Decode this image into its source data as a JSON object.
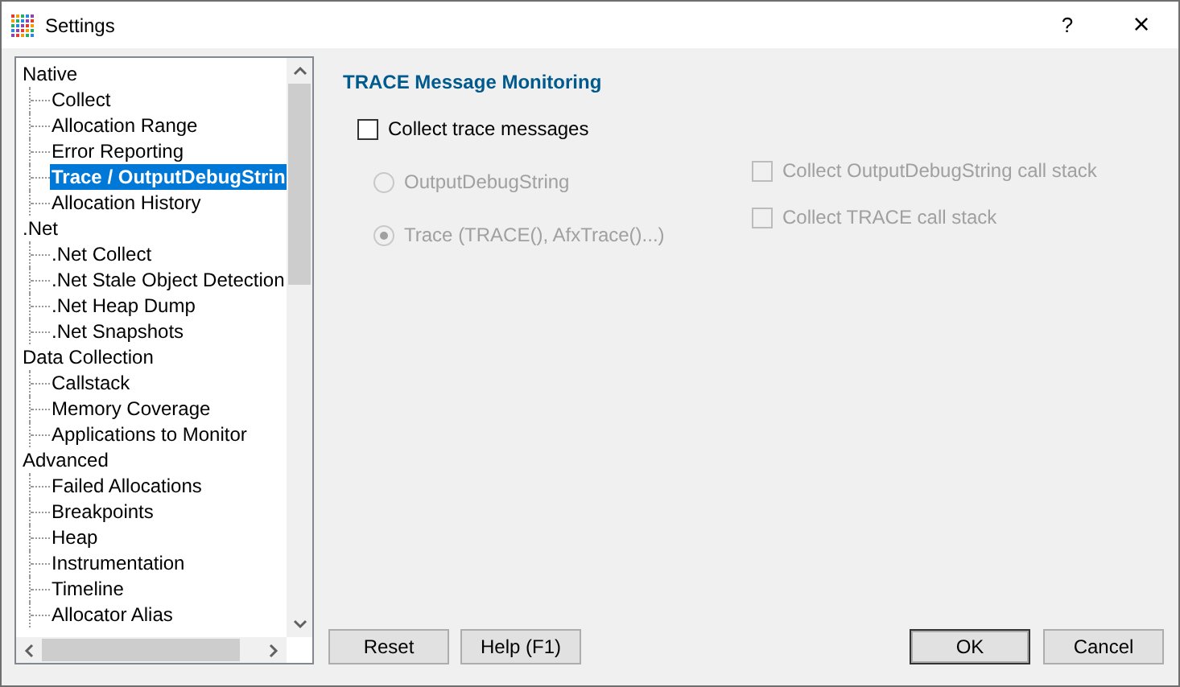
{
  "window": {
    "title": "Settings",
    "help": "?",
    "close": "×"
  },
  "tree": [
    {
      "label": "Native",
      "selected": false,
      "children": [
        {
          "label": "Collect",
          "selected": false
        },
        {
          "label": "Allocation Range",
          "selected": false
        },
        {
          "label": "Error Reporting",
          "selected": false
        },
        {
          "label": "Trace / OutputDebugStrin",
          "selected": true
        },
        {
          "label": "Allocation History",
          "selected": false
        }
      ]
    },
    {
      "label": ".Net",
      "selected": false,
      "children": [
        {
          "label": ".Net Collect",
          "selected": false
        },
        {
          "label": ".Net Stale Object Detection",
          "selected": false
        },
        {
          "label": ".Net Heap Dump",
          "selected": false
        },
        {
          "label": ".Net Snapshots",
          "selected": false
        }
      ]
    },
    {
      "label": "Data Collection",
      "selected": false,
      "children": [
        {
          "label": "Callstack",
          "selected": false
        },
        {
          "label": "Memory Coverage",
          "selected": false
        },
        {
          "label": "Applications to Monitor",
          "selected": false
        }
      ]
    },
    {
      "label": "Advanced",
      "selected": false,
      "children": [
        {
          "label": "Failed Allocations",
          "selected": false
        },
        {
          "label": "Breakpoints",
          "selected": false
        },
        {
          "label": "Heap",
          "selected": false
        },
        {
          "label": "Instrumentation",
          "selected": false
        },
        {
          "label": "Timeline",
          "selected": false
        },
        {
          "label": "Allocator Alias",
          "selected": false
        }
      ]
    }
  ],
  "panel": {
    "heading": "TRACE Message Monitoring",
    "collect": {
      "label": "Collect trace messages",
      "checked": false,
      "disabled": false
    },
    "sources": [
      {
        "label": "OutputDebugString",
        "selected": false,
        "disabled": true
      },
      {
        "label": "Trace (TRACE(), AfxTrace()...)",
        "selected": true,
        "disabled": true
      }
    ],
    "options": [
      {
        "label": "Collect OutputDebugString call stack",
        "checked": false,
        "disabled": true
      },
      {
        "label": "Collect TRACE call stack",
        "checked": false,
        "disabled": true
      }
    ]
  },
  "buttons_left": [
    "Reset",
    "Help (F1)"
  ],
  "buttons_right": [
    {
      "label": "OK",
      "default": true
    },
    {
      "label": "Cancel",
      "default": false
    }
  ]
}
